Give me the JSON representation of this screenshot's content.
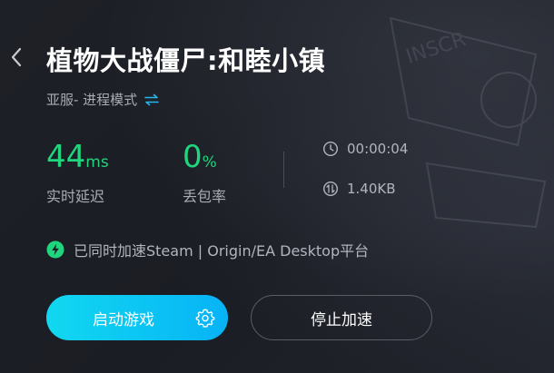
{
  "game": {
    "title": "植物大战僵尸:和睦小镇",
    "server": "亚服- 进程模式"
  },
  "stats": {
    "latency": {
      "value": "44",
      "unit": "ms",
      "label": "实时延迟"
    },
    "packet_loss": {
      "value": "0",
      "unit": "%",
      "label": "丢包率"
    },
    "duration": "00:00:04",
    "traffic": "1.40KB"
  },
  "sync_notice": "已同时加速Steam | Origin/EA Desktop平台",
  "buttons": {
    "start_game": "启动游戏",
    "stop_accel": "停止加速"
  },
  "colors": {
    "accent_green": "#1fd67e",
    "accent_blue": "#07b3f6",
    "background": "#1c1e25"
  },
  "icons": [
    "back-arrow-icon",
    "swap-icon",
    "clock-icon",
    "traffic-icon",
    "lightning-icon",
    "gear-icon"
  ]
}
